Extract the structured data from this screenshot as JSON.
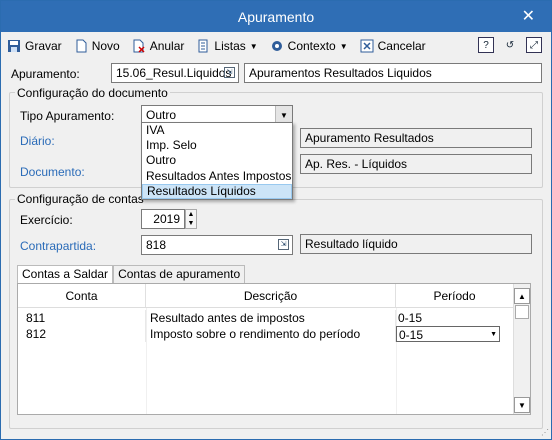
{
  "window": {
    "title": "Apuramento"
  },
  "toolbar": {
    "gravar": "Gravar",
    "novo": "Novo",
    "anular": "Anular",
    "listas": "Listas",
    "contexto": "Contexto",
    "cancelar": "Cancelar"
  },
  "header": {
    "apuramento_label": "Apuramento:",
    "apuramento_code": "15.06_Resul.Liquidos",
    "apuramento_desc": "Apuramentos Resultados Liquidos"
  },
  "config_doc": {
    "title": "Configuração do documento",
    "tipo_label": "Tipo Apuramento:",
    "tipo_value": "Outro",
    "diario_label": "Diário:",
    "diario_desc": "Apuramento Resultados",
    "documento_label": "Documento:",
    "documento_desc": "Ap. Res. - Líquidos",
    "options": [
      "IVA",
      "Imp. Selo",
      "Outro",
      "Resultados Antes Impostos",
      "Resultados Líquidos"
    ]
  },
  "config_contas": {
    "title": "Configuração de contas",
    "exercicio_label": "Exercício:",
    "exercicio_value": "2019",
    "contrapartida_label": "Contrapartida:",
    "contrapartida_value": "818",
    "contrapartida_desc": "Resultado líquido"
  },
  "tabs": [
    "Contas a Saldar",
    "Contas de apuramento"
  ],
  "grid": {
    "columns": [
      "Conta",
      "Descrição",
      "Período"
    ],
    "rows": [
      {
        "conta": "811",
        "descricao": "Resultado antes de impostos",
        "periodo": "0-15"
      },
      {
        "conta": "812",
        "descricao": "Imposto sobre o rendimento do período",
        "periodo": "0-15"
      }
    ]
  }
}
